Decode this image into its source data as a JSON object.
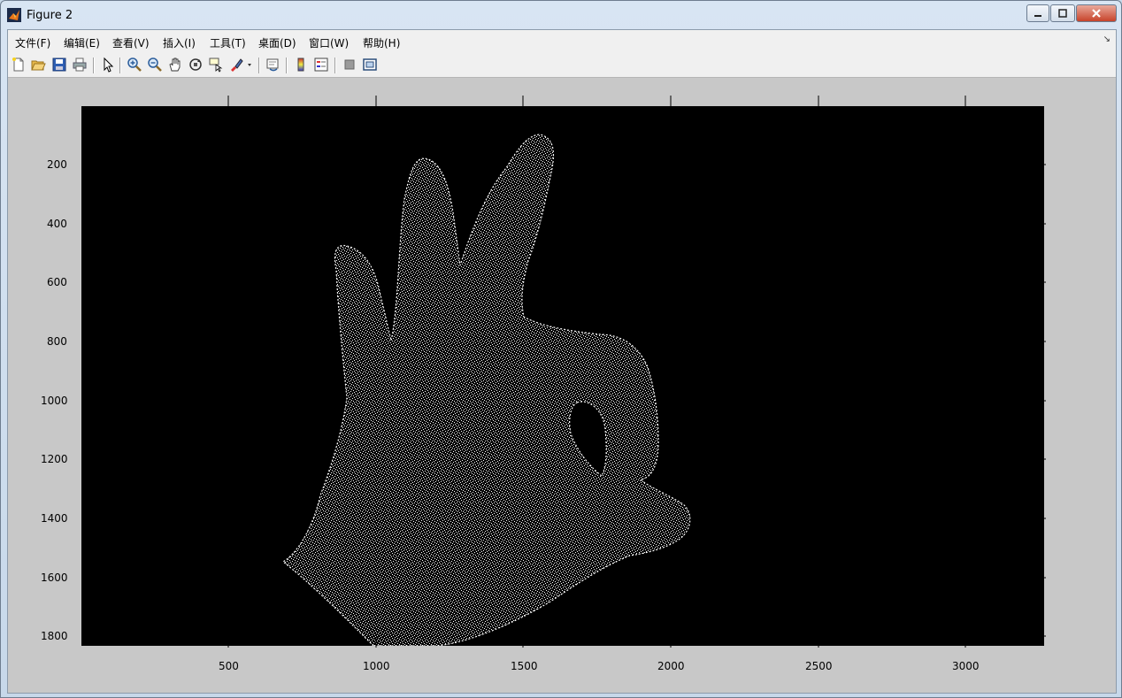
{
  "window": {
    "title": "Figure 2"
  },
  "menu": [
    "文件(F)",
    "编辑(E)",
    "查看(V)",
    "插入(I)",
    "工具(T)",
    "桌面(D)",
    "窗口(W)",
    "帮助(H)"
  ],
  "toolbar": {
    "icons": [
      "new-figure-icon",
      "open-file-icon",
      "save-icon",
      "print-icon",
      "pointer-icon",
      "zoom-in-icon",
      "zoom-out-icon",
      "pan-icon",
      "rotate-3d-icon",
      "data-cursor-icon",
      "brush-icon",
      "link-plot-icon",
      "colorbar-icon",
      "legend-icon",
      "hide-plot-tools-icon",
      "show-plot-tools-icon"
    ]
  },
  "axes": {
    "x_ticks": [
      "500",
      "1000",
      "1500",
      "2000",
      "2500",
      "3000"
    ],
    "y_ticks": [
      "200",
      "400",
      "600",
      "800",
      "1000",
      "1200",
      "1400",
      "1600",
      "1800"
    ],
    "xlim": [
      0,
      3270
    ],
    "ylim": [
      0,
      1830
    ],
    "y_reversed": true,
    "background": "#000000",
    "figure_bg": "#c8c8c8"
  },
  "image": {
    "subject": "hand-gesture-edge-map",
    "foreground": "#ffffff"
  }
}
